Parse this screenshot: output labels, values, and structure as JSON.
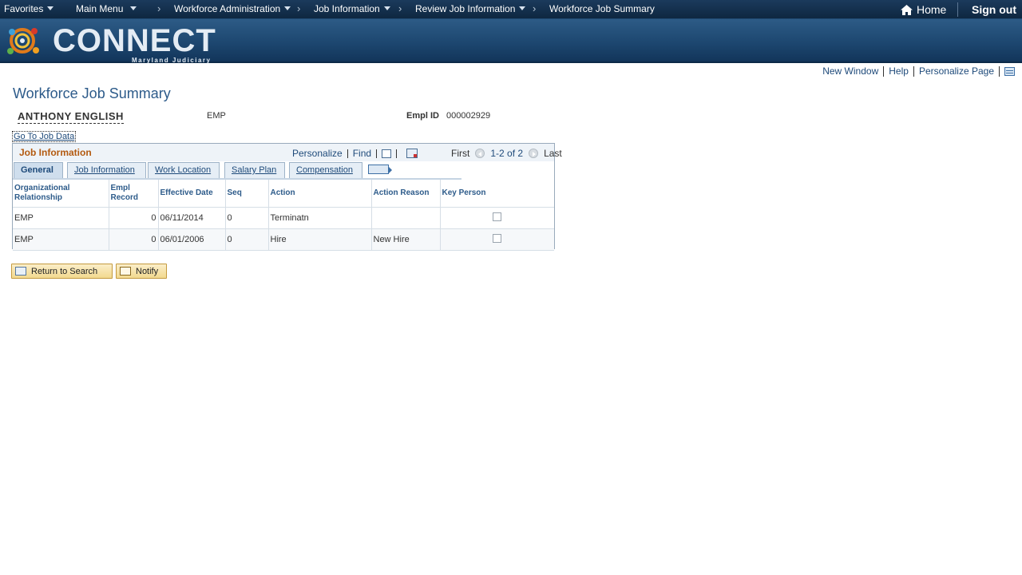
{
  "topnav": {
    "favorites": "Favorites",
    "main_menu": "Main Menu",
    "breadcrumbs": [
      "Workforce Administration",
      "Job Information",
      "Review Job Information",
      "Workforce Job Summary"
    ],
    "home": "Home",
    "signout": "Sign out"
  },
  "banner": {
    "logo_text": "CONNECT",
    "logo_sub": "Maryland Judiciary"
  },
  "pagelinks": {
    "new_window": "New Window",
    "help": "Help",
    "personalize_page": "Personalize Page"
  },
  "page": {
    "title": "Workforce Job Summary",
    "employee_name": "ANTHONY ENGLISH",
    "employee_type": "EMP",
    "emplid_label": "Empl ID",
    "emplid_value": "000002929",
    "goto_job_data": "Go To Job Data"
  },
  "grid": {
    "title": "Job Information",
    "personalize": "Personalize",
    "find": "Find",
    "first": "First",
    "range": "1-2 of 2",
    "last": "Last",
    "tabs": [
      "General",
      "Job Information",
      "Work Location",
      "Salary Plan",
      "Compensation"
    ],
    "columns": [
      "Organizational Relationship",
      "Empl Record",
      "Effective Date",
      "Seq",
      "Action",
      "Action Reason",
      "Key Person"
    ],
    "rows": [
      {
        "org": "EMP",
        "rec": "0",
        "date": "06/11/2014",
        "seq": "0",
        "action": "Terminatn",
        "reason": ""
      },
      {
        "org": "EMP",
        "rec": "0",
        "date": "06/01/2006",
        "seq": "0",
        "action": "Hire",
        "reason": "New Hire"
      }
    ]
  },
  "buttons": {
    "return_to_search": "Return to Search",
    "notify": "Notify"
  }
}
